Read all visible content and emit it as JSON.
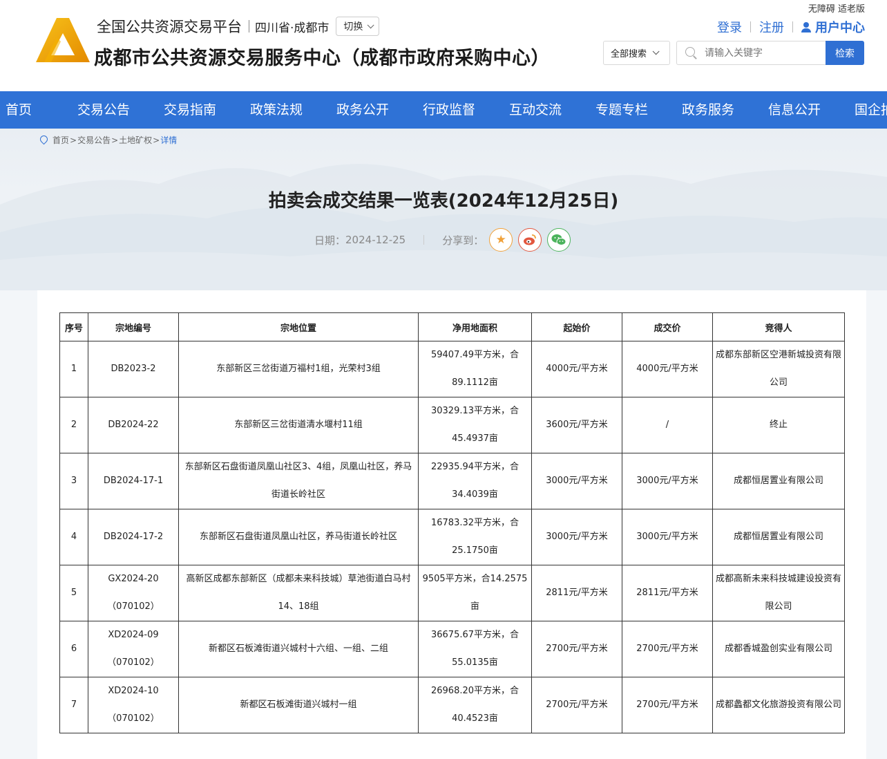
{
  "header": {
    "platform_name": "全国公共资源交易平台",
    "region": "四川省·成都市",
    "switch_label": "切换",
    "site_title": "成都市公共资源交易服务中心（成都市政府采购中心）",
    "accessibility": "无障碍 适老版",
    "login": "登录",
    "register": "注册",
    "user_center": "用户中心",
    "search_scope": "全部搜索",
    "search_placeholder": "请输入关键字",
    "search_button": "检索",
    "logo_colors": {
      "outer": "#f2a900",
      "inner": "#ffffff"
    }
  },
  "nav": {
    "items": [
      {
        "label": "首页"
      },
      {
        "label": "交易公告"
      },
      {
        "label": "交易指南"
      },
      {
        "label": "政策法规"
      },
      {
        "label": "政务公开"
      },
      {
        "label": "行政监督"
      },
      {
        "label": "互动交流"
      },
      {
        "label": "专题专栏"
      },
      {
        "label": "政务服务"
      },
      {
        "label": "信息公开"
      },
      {
        "label": "国企拍"
      }
    ],
    "color": "#2f72d6"
  },
  "breadcrumb": {
    "home": "首页",
    "sep": ">",
    "level1": "交易公告",
    "level2": "土地矿权",
    "current": "详情"
  },
  "article": {
    "title": "拍卖会成交结果一览表(2024年12月25日)",
    "date_label": "日期：",
    "date": "2024-12-25",
    "share_label": "分享到：",
    "share_icons": [
      "star-icon",
      "weibo-icon",
      "wechat-icon"
    ]
  },
  "table": {
    "headers": [
      "序号",
      "宗地编号",
      "宗地位置",
      "净用地面积",
      "起始价",
      "成交价",
      "竞得人"
    ],
    "rows": [
      {
        "no": "1",
        "code": "DB2023-2",
        "location": "东部新区三岔街道万福村1组，光荣村3组",
        "area": "59407.49平方米，合89.1112亩",
        "start_price": "4000元/平方米",
        "deal_price": "4000元/平方米",
        "winner": "成都东部新区空港新城投资有限公司"
      },
      {
        "no": "2",
        "code": "DB2024-22",
        "location": "东部新区三岔街道清水堰村11组",
        "area": "30329.13平方米，合45.4937亩",
        "start_price": "3600元/平方米",
        "deal_price": "/",
        "winner": "终止"
      },
      {
        "no": "3",
        "code": "DB2024-17-1",
        "location": "东部新区石盘街道凤凰山社区3、4组，凤凰山社区，养马街道长岭社区",
        "area": "22935.94平方米，合34.4039亩",
        "start_price": "3000元/平方米",
        "deal_price": "3000元/平方米",
        "winner": "成都恒居置业有限公司"
      },
      {
        "no": "4",
        "code": "DB2024-17-2",
        "location": "东部新区石盘街道凤凰山社区，养马街道长岭社区",
        "area": "16783.32平方米，合25.1750亩",
        "start_price": "3000元/平方米",
        "deal_price": "3000元/平方米",
        "winner": "成都恒居置业有限公司"
      },
      {
        "no": "5",
        "code": "GX2024-20（070102）",
        "location": "高新区成都东部新区（成都未来科技城）草池街道白马村14、18组",
        "area": "9505平方米，合14.2575亩",
        "start_price": "2811元/平方米",
        "deal_price": "2811元/平方米",
        "winner": "成都高新未来科技城建设投资有限公司"
      },
      {
        "no": "6",
        "code": "XD2024-09（070102）",
        "location": "新都区石板滩街道兴城村十六组、一组、二组",
        "area": "36675.67平方米，合55.0135亩",
        "start_price": "2700元/平方米",
        "deal_price": "2700元/平方米",
        "winner": "成都香城盈创实业有限公司"
      },
      {
        "no": "7",
        "code": "XD2024-10（070102）",
        "location": "新都区石板滩街道兴城村一组",
        "area": "26968.20平方米，合40.4523亩",
        "start_price": "2700元/平方米",
        "deal_price": "2700元/平方米",
        "winner": "成都蠡都文化旅游投资有限公司"
      }
    ]
  }
}
